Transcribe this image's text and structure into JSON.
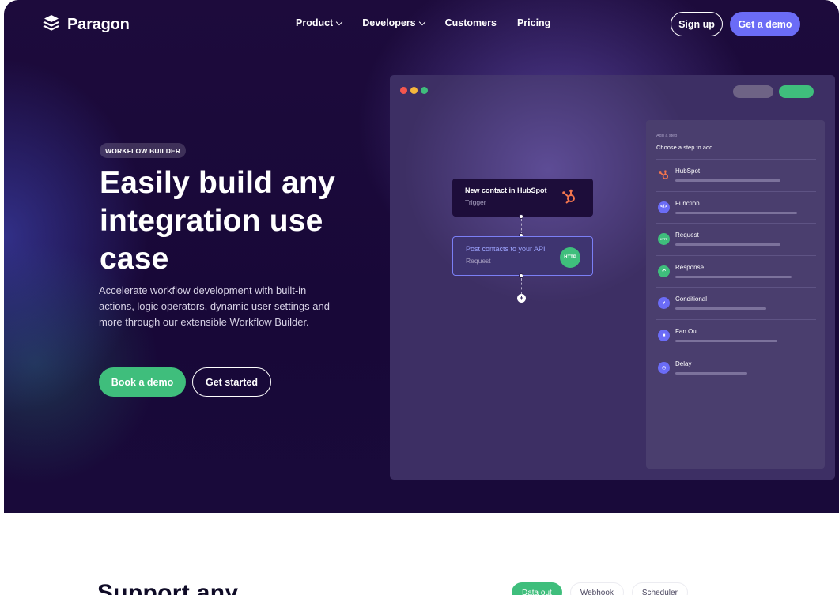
{
  "brand": {
    "name": "Paragon",
    "icon": "stack-layers-icon"
  },
  "nav": {
    "items": [
      {
        "label": "Product",
        "has_dropdown": true
      },
      {
        "label": "Developers",
        "has_dropdown": true
      },
      {
        "label": "Customers",
        "has_dropdown": false
      },
      {
        "label": "Pricing",
        "has_dropdown": false
      }
    ],
    "signup": "Sign up",
    "get_demo": "Get a demo"
  },
  "hero": {
    "badge": "WORKFLOW BUILDER",
    "headline": "Easily build any integration use case",
    "subtext": "Accelerate workflow development with built-in actions, logic operators, dynamic user settings and more through our extensible Workflow Builder.",
    "cta_primary": "Book a demo",
    "cta_secondary": "Get started"
  },
  "workflow": {
    "trigger": {
      "title": "New contact in HubSpot",
      "subtitle": "Trigger",
      "icon": "hubspot-icon"
    },
    "request": {
      "title": "Post contacts to your API",
      "subtitle": "Request",
      "badge": "HTTP"
    }
  },
  "panel": {
    "caption": "Add a step",
    "title": "Choose a step to add",
    "steps": [
      {
        "label": "HubSpot",
        "icon": "hubspot-icon",
        "color": "#f2754e",
        "bar": 0.66
      },
      {
        "label": "Function",
        "icon": "code-icon",
        "color": "#6b6cf6",
        "bar": 0.76
      },
      {
        "label": "Request",
        "icon": "http-icon",
        "color": "#3fbe7c",
        "bar": 0.66,
        "icon_text": "HTTP"
      },
      {
        "label": "Response",
        "icon": "reply-icon",
        "color": "#3fbe7c",
        "bar": 0.73
      },
      {
        "label": "Conditional",
        "icon": "branch-icon",
        "color": "#6b6cf6",
        "bar": 0.57
      },
      {
        "label": "Fan Out",
        "icon": "fan-out-icon",
        "color": "#6b6cf6",
        "bar": 0.64
      },
      {
        "label": "Delay",
        "icon": "clock-icon",
        "color": "#6b6cf6",
        "bar": 0.45
      }
    ]
  },
  "colors": {
    "accent": "#6b6cf6",
    "green": "#3fbe7c",
    "hubspot": "#f2754e",
    "dot_red": "#f5564e",
    "dot_yellow": "#f6b73c",
    "dot_green": "#3fbe7c"
  },
  "section": {
    "title": "Support any",
    "tabs": [
      {
        "label": "Data out",
        "active": true
      },
      {
        "label": "Webhook",
        "active": false
      },
      {
        "label": "Scheduler",
        "active": false
      }
    ]
  }
}
